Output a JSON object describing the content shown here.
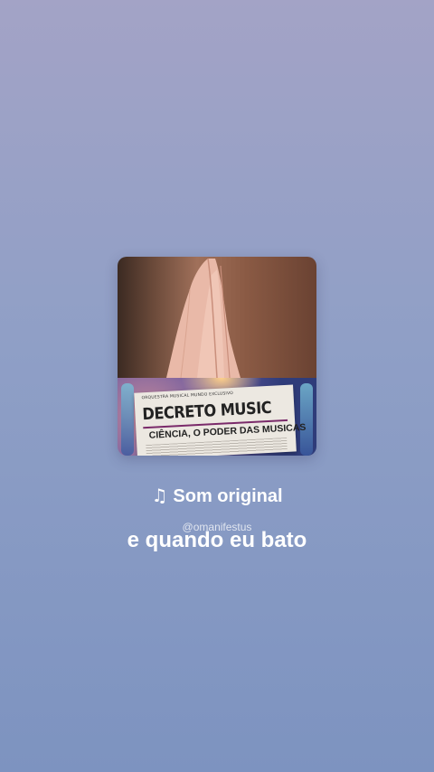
{
  "audio": {
    "icon": "music-note-icon",
    "label": "Som original"
  },
  "watermark": "@omanifestus",
  "caption": "e quando eu bato",
  "cover": {
    "small_line": "ORQUESTRA MUSICAL MUNDO EXCLUSIVO",
    "headline": "DECRETO MUSIC",
    "subheadline": "CIÊNCIA, O PODER DAS MUSICAS"
  }
}
